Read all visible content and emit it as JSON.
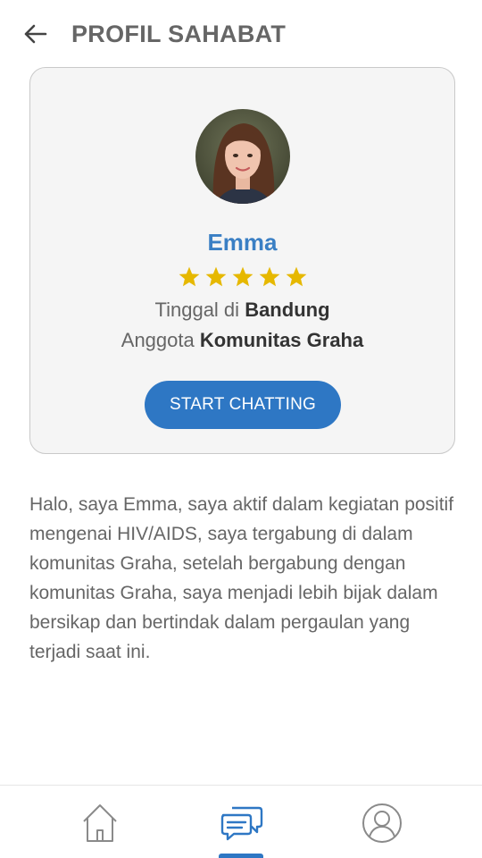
{
  "header": {
    "title": "PROFIL SAHABAT",
    "back_icon": "arrow-left-icon"
  },
  "profile": {
    "name": "Emma",
    "rating": 5,
    "rating_max": 5,
    "star_color": "#e6b800",
    "location_prefix": "Tinggal di",
    "location": "Bandung",
    "community_prefix": "Anggota",
    "community": "Komunitas Graha",
    "button_label": "START CHATTING"
  },
  "bio": "Halo, saya Emma, saya aktif dalam kegiatan positif mengenai HIV/AIDS, saya tergabung di dalam komunitas Graha, setelah bergabung dengan komunitas Graha, saya menjadi lebih bijak dalam bersikap dan bertindak dalam pergaulan yang terjadi saat ini.",
  "bottom_nav": {
    "items": [
      {
        "icon": "home-icon",
        "active": false
      },
      {
        "icon": "chat-icon",
        "active": true
      },
      {
        "icon": "user-profile-icon",
        "active": false
      }
    ],
    "accent_color": "#2e77c4"
  }
}
